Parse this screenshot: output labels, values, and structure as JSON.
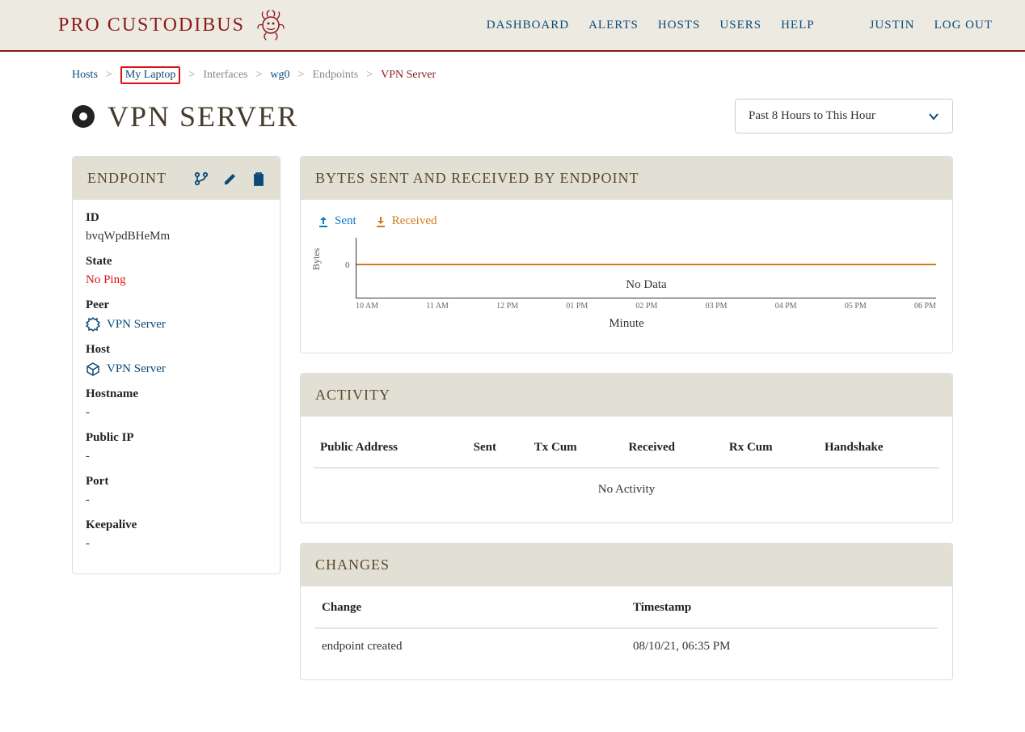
{
  "brand": "PRO CUSTODIBUS",
  "nav": {
    "dashboard": "DASHBOARD",
    "alerts": "ALERTS",
    "hosts": "HOSTS",
    "users": "USERS",
    "help": "HELP",
    "username": "JUSTIN",
    "logout": "LOG OUT"
  },
  "breadcrumb": {
    "hosts": "Hosts",
    "host": "My Laptop",
    "interfaces": "Interfaces",
    "iface": "wg0",
    "endpoints": "Endpoints",
    "current": "VPN Server"
  },
  "page_title": "VPN SERVER",
  "timerange": "Past 8 Hours to This Hour",
  "endpoint_panel": {
    "title": "ENDPOINT",
    "id_label": "ID",
    "id": "bvqWpdBHeMm",
    "state_label": "State",
    "state": "No Ping",
    "peer_label": "Peer",
    "peer": "VPN Server",
    "host_label": "Host",
    "host": "VPN Server",
    "hostname_label": "Hostname",
    "hostname": "-",
    "publicip_label": "Public IP",
    "publicip": "-",
    "port_label": "Port",
    "port": "-",
    "keepalive_label": "Keepalive",
    "keepalive": "-"
  },
  "chart_panel": {
    "title": "BYTES SENT AND RECEIVED BY ENDPOINT",
    "sent": "Sent",
    "received": "Received",
    "ylabel": "Bytes",
    "zero": "0",
    "nodata": "No Data",
    "xlabel": "Minute"
  },
  "chart_data": {
    "type": "line",
    "title": "Bytes Sent and Received by Endpoint",
    "xlabel": "Minute",
    "ylabel": "Bytes",
    "categories": [
      "10 AM",
      "11 AM",
      "12 PM",
      "01 PM",
      "02 PM",
      "03 PM",
      "04 PM",
      "05 PM",
      "06 PM"
    ],
    "series": [
      {
        "name": "Sent",
        "values": [
          null,
          null,
          null,
          null,
          null,
          null,
          null,
          null,
          null
        ]
      },
      {
        "name": "Received",
        "values": [
          null,
          null,
          null,
          null,
          null,
          null,
          null,
          null,
          null
        ]
      }
    ],
    "ylim": [
      0,
      0
    ],
    "note": "No Data"
  },
  "activity_panel": {
    "title": "ACTIVITY",
    "cols": {
      "addr": "Public Address",
      "sent": "Sent",
      "txcum": "Tx Cum",
      "received": "Received",
      "rxcum": "Rx Cum",
      "handshake": "Handshake"
    },
    "empty": "No Activity"
  },
  "changes_panel": {
    "title": "CHANGES",
    "cols": {
      "change": "Change",
      "timestamp": "Timestamp"
    },
    "rows": [
      {
        "change": "endpoint created",
        "timestamp": "08/10/21, 06:35 PM"
      }
    ]
  }
}
